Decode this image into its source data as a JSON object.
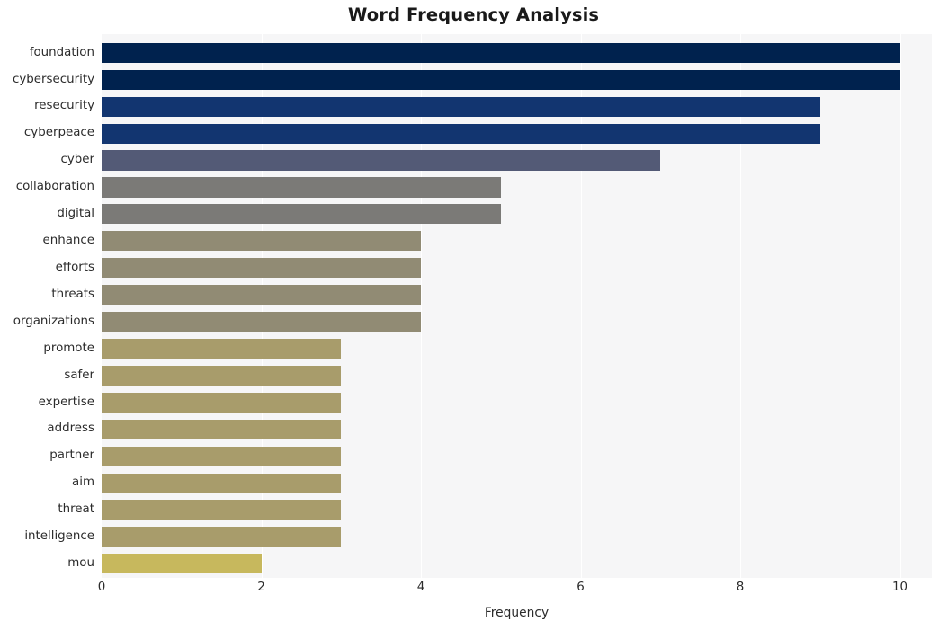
{
  "chart_data": {
    "type": "bar",
    "orientation": "horizontal",
    "title": "Word Frequency Analysis",
    "xlabel": "Frequency",
    "ylabel": "",
    "xlim": [
      0,
      10.4
    ],
    "xticks": [
      0,
      2,
      4,
      6,
      8,
      10
    ],
    "grid": "vertical",
    "legend": "none",
    "categories": [
      "foundation",
      "cybersecurity",
      "resecurity",
      "cyberpeace",
      "cyber",
      "collaboration",
      "digital",
      "enhance",
      "efforts",
      "threats",
      "organizations",
      "promote",
      "safer",
      "expertise",
      "address",
      "partner",
      "aim",
      "threat",
      "intelligence",
      "mou"
    ],
    "values": [
      10,
      10,
      9,
      9,
      7,
      5,
      5,
      4,
      4,
      4,
      4,
      3,
      3,
      3,
      3,
      3,
      3,
      3,
      3,
      2
    ],
    "bar_colors": [
      "#00224e",
      "#00224e",
      "#123570",
      "#123570",
      "#535a76",
      "#7b7a77",
      "#7b7a77",
      "#918b74",
      "#918b74",
      "#918b74",
      "#918b74",
      "#a89c6b",
      "#a89c6b",
      "#a89c6b",
      "#a89c6b",
      "#a89c6b",
      "#a89c6b",
      "#a89c6b",
      "#a89c6b",
      "#c7b85d"
    ],
    "plot_background": "#f6f6f7",
    "gridline_color": "#ffffff",
    "figure_background": "#ffffff",
    "title_color": "#1a1a1a",
    "tick_label_color": "#2b2b2b"
  }
}
